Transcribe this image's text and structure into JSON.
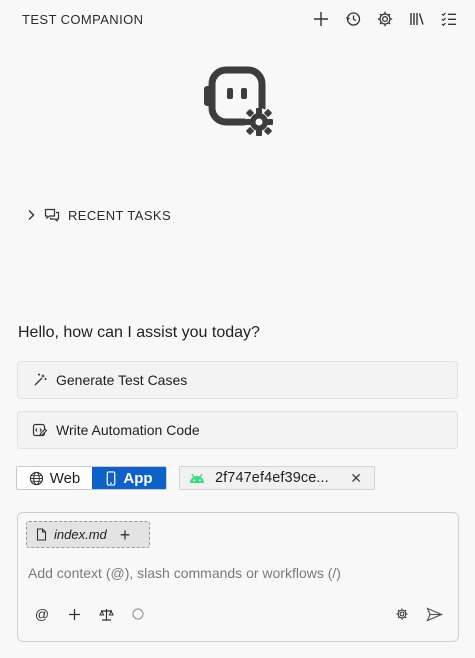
{
  "header": {
    "title": "TEST COMPANION",
    "icons": [
      "plus-icon",
      "history-icon",
      "gear-icon",
      "library-icon",
      "checklist-icon"
    ]
  },
  "logo": {
    "icon": "robot-gear-logo-icon"
  },
  "recent_tasks": {
    "label": "RECENT TASKS",
    "expanded": false
  },
  "greeting": "Hello, how can I assist you today?",
  "actions": [
    {
      "label": "Generate Test Cases",
      "icon": "magic-wand-icon"
    },
    {
      "label": "Write Automation Code",
      "icon": "code-edit-icon"
    }
  ],
  "platform_toggle": {
    "options": [
      "Web",
      "App"
    ],
    "selected": "App",
    "selected_color": "#0e62c7"
  },
  "device": {
    "id": "2f747ef4ef39ce...",
    "icon": "android-icon",
    "accent": "#3ddc84"
  },
  "composer": {
    "context_chip": "index.md",
    "placeholder": "Add context (@), slash commands or workflows (/)",
    "toolbar": [
      "at-icon",
      "plus-icon",
      "scale-icon",
      "circle-icon"
    ],
    "toolbar_right": [
      "gear-icon",
      "send-icon"
    ]
  }
}
